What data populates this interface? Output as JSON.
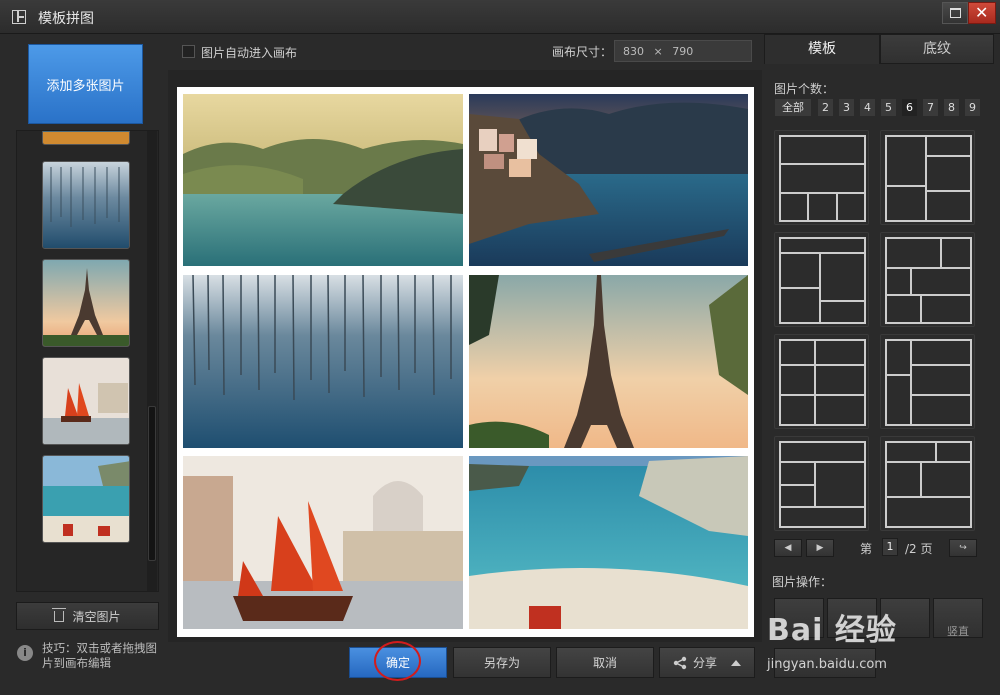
{
  "window": {
    "title": "模板拼图"
  },
  "left_panel": {
    "add_button": "添加多张图片",
    "clear_button": "清空图片",
    "tip_icon": "i",
    "tip": "技巧：双击或者拖拽图片到画布编辑"
  },
  "center": {
    "auto_enter_label": "图片自动进入画布",
    "canvas_size_label": "画布尺寸：",
    "canvas_width": "830",
    "canvas_times": "×",
    "canvas_height": "790"
  },
  "buttons": {
    "ok": "确定",
    "save_as": "另存为",
    "cancel": "取消",
    "share": "分享"
  },
  "right_panel": {
    "tabs": [
      "模板",
      "底纹"
    ],
    "count_label": "图片个数：",
    "count_options": [
      "全部",
      "2",
      "3",
      "4",
      "5",
      "6",
      "7",
      "8",
      "9"
    ],
    "selected_count": "6",
    "page_prefix": "第",
    "page_current": "1",
    "page_suffix": "/2 页",
    "operations_label": "图片操作：",
    "operation_button": "竖直"
  },
  "watermark": {
    "main": "Bai 经验",
    "sub": "jingyan.baidu.com"
  },
  "icons": [
    "template-grid-icon",
    "maximize-icon",
    "close-icon",
    "trash-icon",
    "info-icon",
    "share-icon",
    "chevron-up-icon",
    "prev-page-icon",
    "next-page-icon",
    "return-icon"
  ],
  "colors": {
    "accent_blue": "#2a72c8",
    "close_red": "#c0392b",
    "highlight_circle": "#d21c1c"
  }
}
